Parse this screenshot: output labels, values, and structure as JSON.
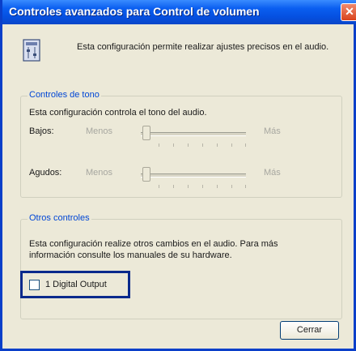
{
  "window": {
    "title": "Controles avanzados para Control de volumen",
    "close_symbol": "✕"
  },
  "header": {
    "description": "Esta configuración permite realizar ajustes precisos en el audio.",
    "icon": "speaker-settings-icon"
  },
  "tone_group": {
    "legend": "Controles de tono",
    "description": "Esta configuración controla el tono del audio.",
    "bass": {
      "label": "Bajos:",
      "min_label": "Menos",
      "max_label": "Más",
      "level": 0
    },
    "treble": {
      "label": "Agudos:",
      "min_label": "Menos",
      "max_label": "Más",
      "level": 0
    }
  },
  "other_group": {
    "legend": "Otros controles",
    "description_line1": "Esta configuración realize otros cambios en el audio. Para más",
    "description_line2": "información consulte los manuales de su hardware.",
    "digital_output": {
      "label": "1 Digital Output",
      "checked": false
    }
  },
  "footer": {
    "close_button_label": "Cerrar"
  },
  "colors": {
    "title_bar": "#0a5ef0",
    "legend_text": "#0046d5",
    "highlight_border": "#0a2a8c"
  }
}
